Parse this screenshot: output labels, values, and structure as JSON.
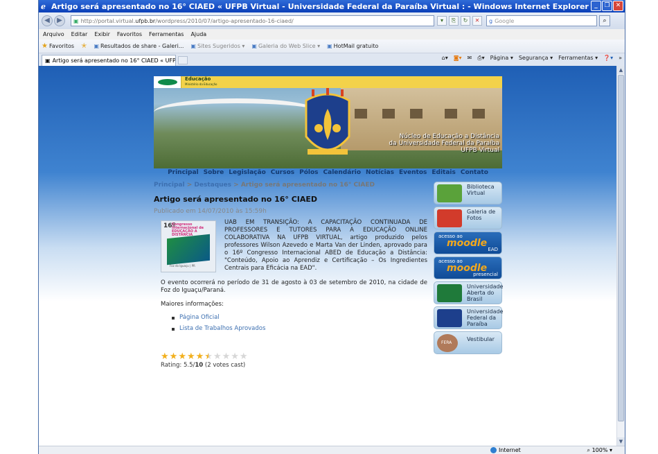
{
  "window": {
    "title": "Artigo será apresentado no 16° CIAED « UFPB Virtual - Universidade Federal da Paraíba Virtual : - Windows Internet Explorer"
  },
  "address_bar": {
    "url_prefix": "http://portal.virtual.",
    "url_domain": "ufpb.br",
    "url_suffix": "/wordpress/2010/07/artigo-apresentado-16-ciaed/",
    "search_placeholder": "Google"
  },
  "menu": [
    "Arquivo",
    "Editar",
    "Exibir",
    "Favoritos",
    "Ferramentas",
    "Ajuda"
  ],
  "favorites_bar": {
    "favorites_label": "Favoritos",
    "items": [
      {
        "label": "Resultados de share - Galeri...",
        "dim": false
      },
      {
        "label": "Sites Sugeridos ▾",
        "dim": true
      },
      {
        "label": "Galeria do Web Slice ▾",
        "dim": true
      },
      {
        "label": "HotMail gratuito",
        "dim": false
      }
    ]
  },
  "tab": {
    "label": "Artigo será apresentado no 16° CIAED « UFPB Virtual ..."
  },
  "command_bar": [
    "Página ▾",
    "Segurança ▾",
    "Ferramentas ▾"
  ],
  "banner": {
    "ministry_title": "Educação",
    "ministry_sub": "Ministério da Educação",
    "line1": "Núcleo de Educação a Distância",
    "line2": "da Universidade Federal da Paraíba",
    "line3": "UFPB Virtual"
  },
  "nav": [
    "Principal",
    "Sobre",
    "Legislação",
    "Cursos",
    "Pólos",
    "Calendário",
    "Notícias",
    "Eventos",
    "Editais",
    "Contato"
  ],
  "breadcrumb": {
    "home": "Principal",
    "section": "Destaques",
    "current": "Artigo será apresentado no 16° CIAED",
    "sep": ">"
  },
  "article": {
    "title": "Artigo será apresentado no 16° CIAED",
    "published": "Publicado em 14/07/2010 às 15:59h",
    "p1": "UAB EM TRANSIÇÃO: A CAPACITAÇÃO CONTINUADA DE PROFESSORES E TUTORES PARA A EDUCAÇÃO ONLINE COLABORATIVA NA UFPB VIRTUAL, artigo produzido pelos professores Wilson Azevedo e Marta Van der Linden, aprovado para o 16º Congresso Internacional ABED de Educação a Distância: \"Conteúdo, Apoio ao Aprendiz e Certificação – Os Ingredientes Centrais para Eficácia na EAD\".",
    "p2": "O evento ocorrerá no período de 31 de agosto à 03 de setembro de 2010, na cidade de Foz do Iguaçu/Paraná.",
    "more_info": "Maiores informações:",
    "links": [
      "Página Oficial",
      "Lista de Trabalhos Aprovados"
    ],
    "image_number": "16º",
    "image_title": "Congresso Internacional de EDUCAÇÃO A DISTÂNCIA",
    "image_footer": "Foz do Iguaçu | PR"
  },
  "rating": {
    "stars_on": 5.5,
    "stars_total": 10,
    "label_prefix": "Rating: 5.5/",
    "label_max": "10",
    "label_suffix": " (2 votes cast)"
  },
  "sidebar": [
    {
      "label": "Biblioteca Virtual",
      "icon": "book-icon",
      "color": "#5aa23a"
    },
    {
      "label": "Galeria de Fotos",
      "icon": "photos-icon",
      "color": "#d23b2b"
    },
    {
      "label": "EAD",
      "icon": "moodle-icon",
      "moodle": true,
      "access": "acesso ao",
      "brand": "moodle"
    },
    {
      "label": "presencial",
      "icon": "moodle-icon",
      "moodle": true,
      "access": "acesso ao",
      "brand": "moodle"
    },
    {
      "label": "Universidade Aberta do Brasil",
      "icon": "uab-icon",
      "color": "#1f7a3a"
    },
    {
      "label": "Universidade Federal da Paraíba",
      "icon": "ufpb-crest-icon",
      "color": "#1d3f8c"
    },
    {
      "label": "Vestibular",
      "icon": "vestibular-icon",
      "color": "#b07a5a",
      "badge": "FERA"
    }
  ],
  "status_bar": {
    "zone": "Internet",
    "zoom": "100%"
  },
  "colors": {
    "link": "#3c6fb0",
    "nav": "#143a70",
    "star": "#f2b01e",
    "ie_blue": "#0a3fb8"
  }
}
